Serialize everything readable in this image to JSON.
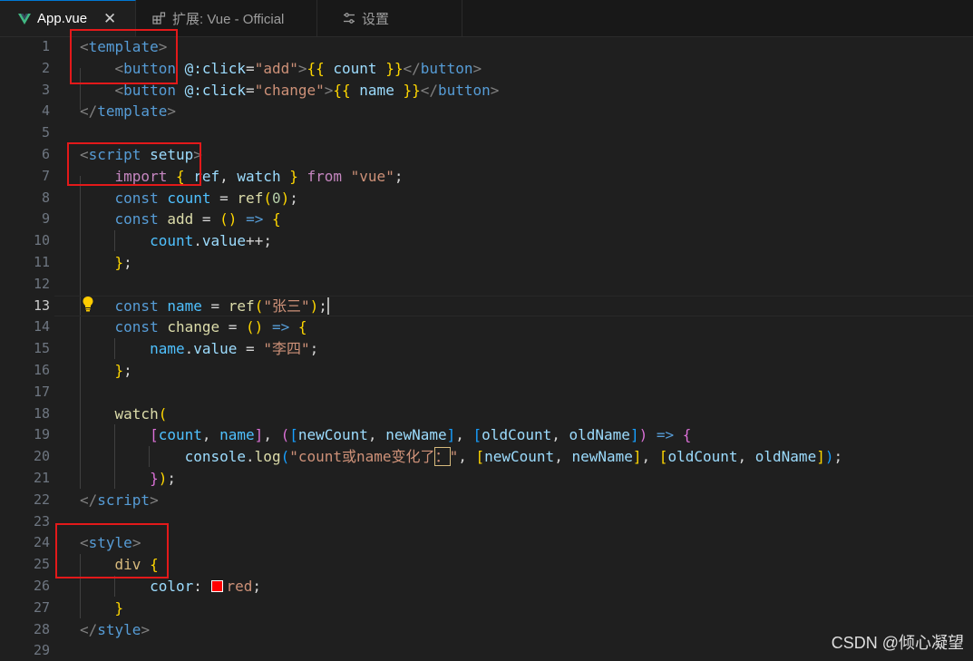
{
  "tabs": [
    {
      "label": "App.vue",
      "icon": "vue-file-icon",
      "close": "✕",
      "active": true
    },
    {
      "label": "扩展: Vue - Official",
      "icon": "extensions-icon",
      "active": false
    },
    {
      "label": "设置",
      "icon": "settings-icon",
      "active": false
    }
  ],
  "editor": {
    "current_line": 13,
    "lines": [
      {
        "n": "1"
      },
      {
        "n": "2"
      },
      {
        "n": "3"
      },
      {
        "n": "4"
      },
      {
        "n": "5"
      },
      {
        "n": "6"
      },
      {
        "n": "7"
      },
      {
        "n": "8"
      },
      {
        "n": "9"
      },
      {
        "n": "10"
      },
      {
        "n": "11"
      },
      {
        "n": "12"
      },
      {
        "n": "13"
      },
      {
        "n": "14"
      },
      {
        "n": "15"
      },
      {
        "n": "16"
      },
      {
        "n": "17"
      },
      {
        "n": "18"
      },
      {
        "n": "19"
      },
      {
        "n": "20"
      },
      {
        "n": "21"
      },
      {
        "n": "22"
      },
      {
        "n": "23"
      },
      {
        "n": "24"
      },
      {
        "n": "25"
      },
      {
        "n": "26"
      },
      {
        "n": "27"
      },
      {
        "n": "28"
      },
      {
        "n": "29"
      }
    ],
    "code": [
      [
        [
          "t-pun",
          "<"
        ],
        [
          "t-tag",
          "template"
        ],
        [
          "t-pun",
          ">"
        ]
      ],
      [
        [
          "t-txt",
          "    "
        ],
        [
          "t-pun",
          "<"
        ],
        [
          "t-tag",
          "button"
        ],
        [
          "t-txt",
          " "
        ],
        [
          "t-attr",
          "@:click"
        ],
        [
          "t-txt",
          "="
        ],
        [
          "t-str",
          "\"add\""
        ],
        [
          "t-pun",
          ">"
        ],
        [
          "t-y",
          "{{"
        ],
        [
          "t-var",
          " count "
        ],
        [
          "t-y",
          "}}"
        ],
        [
          "t-pun",
          "</"
        ],
        [
          "t-tag",
          "button"
        ],
        [
          "t-pun",
          ">"
        ]
      ],
      [
        [
          "t-txt",
          "    "
        ],
        [
          "t-pun",
          "<"
        ],
        [
          "t-tag",
          "button"
        ],
        [
          "t-txt",
          " "
        ],
        [
          "t-attr",
          "@:click"
        ],
        [
          "t-txt",
          "="
        ],
        [
          "t-str",
          "\"change\""
        ],
        [
          "t-pun",
          ">"
        ],
        [
          "t-y",
          "{{"
        ],
        [
          "t-var",
          " name "
        ],
        [
          "t-y",
          "}}"
        ],
        [
          "t-pun",
          "</"
        ],
        [
          "t-tag",
          "button"
        ],
        [
          "t-pun",
          ">"
        ]
      ],
      [
        [
          "t-pun",
          "</"
        ],
        [
          "t-tag",
          "template"
        ],
        [
          "t-pun",
          ">"
        ]
      ],
      [],
      [
        [
          "t-pun",
          "<"
        ],
        [
          "t-tag",
          "script"
        ],
        [
          "t-txt",
          " "
        ],
        [
          "t-attr",
          "setup"
        ],
        [
          "t-pun",
          ">"
        ]
      ],
      [
        [
          "t-txt",
          "    "
        ],
        [
          "t-ctrl",
          "import"
        ],
        [
          "t-txt",
          " "
        ],
        [
          "t-y",
          "{"
        ],
        [
          "t-var",
          " ref"
        ],
        [
          "t-txt",
          ", "
        ],
        [
          "t-var",
          "watch "
        ],
        [
          "t-y",
          "}"
        ],
        [
          "t-txt",
          " "
        ],
        [
          "t-ctrl",
          "from"
        ],
        [
          "t-txt",
          " "
        ],
        [
          "t-str",
          "\"vue\""
        ],
        [
          "t-txt",
          ";"
        ]
      ],
      [
        [
          "t-txt",
          "    "
        ],
        [
          "t-kw",
          "const"
        ],
        [
          "t-txt",
          " "
        ],
        [
          "t-const",
          "count"
        ],
        [
          "t-txt",
          " = "
        ],
        [
          "t-fn",
          "ref"
        ],
        [
          "t-y",
          "("
        ],
        [
          "t-num",
          "0"
        ],
        [
          "t-y",
          ")"
        ],
        [
          "t-txt",
          ";"
        ]
      ],
      [
        [
          "t-txt",
          "    "
        ],
        [
          "t-kw",
          "const"
        ],
        [
          "t-txt",
          " "
        ],
        [
          "t-fn",
          "add"
        ],
        [
          "t-txt",
          " = "
        ],
        [
          "t-y",
          "()"
        ],
        [
          "t-txt",
          " "
        ],
        [
          "t-kw",
          "=>"
        ],
        [
          "t-txt",
          " "
        ],
        [
          "t-y",
          "{"
        ]
      ],
      [
        [
          "t-txt",
          "        "
        ],
        [
          "t-const",
          "count"
        ],
        [
          "t-txt",
          "."
        ],
        [
          "t-var",
          "value"
        ],
        [
          "t-txt",
          "++;"
        ]
      ],
      [
        [
          "t-txt",
          "    "
        ],
        [
          "t-y",
          "}"
        ],
        [
          "t-txt",
          ";"
        ]
      ],
      [],
      [
        [
          "t-txt",
          "    "
        ],
        [
          "t-kw",
          "const"
        ],
        [
          "t-txt",
          " "
        ],
        [
          "t-const",
          "name"
        ],
        [
          "t-txt",
          " = "
        ],
        [
          "t-fn",
          "ref"
        ],
        [
          "t-y",
          "("
        ],
        [
          "t-str",
          "\"张三\""
        ],
        [
          "t-y",
          ")"
        ],
        [
          "t-txt",
          ";"
        ],
        [
          "cursor",
          ""
        ]
      ],
      [
        [
          "t-txt",
          "    "
        ],
        [
          "t-kw",
          "const"
        ],
        [
          "t-txt",
          " "
        ],
        [
          "t-fn",
          "change"
        ],
        [
          "t-txt",
          " = "
        ],
        [
          "t-y",
          "()"
        ],
        [
          "t-txt",
          " "
        ],
        [
          "t-kw",
          "=>"
        ],
        [
          "t-txt",
          " "
        ],
        [
          "t-y",
          "{"
        ]
      ],
      [
        [
          "t-txt",
          "        "
        ],
        [
          "t-const",
          "name"
        ],
        [
          "t-txt",
          "."
        ],
        [
          "t-var",
          "value"
        ],
        [
          "t-txt",
          " = "
        ],
        [
          "t-str",
          "\"李四\""
        ],
        [
          "t-txt",
          ";"
        ]
      ],
      [
        [
          "t-txt",
          "    "
        ],
        [
          "t-y",
          "}"
        ],
        [
          "t-txt",
          ";"
        ]
      ],
      [],
      [
        [
          "t-txt",
          "    "
        ],
        [
          "t-fn",
          "watch"
        ],
        [
          "t-y",
          "("
        ]
      ],
      [
        [
          "t-txt",
          "        "
        ],
        [
          "t-p",
          "["
        ],
        [
          "t-const",
          "count"
        ],
        [
          "t-txt",
          ", "
        ],
        [
          "t-const",
          "name"
        ],
        [
          "t-p",
          "]"
        ],
        [
          "t-txt",
          ", "
        ],
        [
          "t-p",
          "("
        ],
        [
          "t-b",
          "["
        ],
        [
          "t-var",
          "newCount"
        ],
        [
          "t-txt",
          ", "
        ],
        [
          "t-var",
          "newName"
        ],
        [
          "t-b",
          "]"
        ],
        [
          "t-txt",
          ", "
        ],
        [
          "t-b",
          "["
        ],
        [
          "t-var",
          "oldCount"
        ],
        [
          "t-txt",
          ", "
        ],
        [
          "t-var",
          "oldName"
        ],
        [
          "t-b",
          "]"
        ],
        [
          "t-p",
          ")"
        ],
        [
          "t-txt",
          " "
        ],
        [
          "t-kw",
          "=>"
        ],
        [
          "t-txt",
          " "
        ],
        [
          "t-p",
          "{"
        ]
      ],
      [
        [
          "t-txt",
          "            "
        ],
        [
          "t-var",
          "console"
        ],
        [
          "t-txt",
          "."
        ],
        [
          "t-fn",
          "log"
        ],
        [
          "t-b",
          "("
        ],
        [
          "t-str",
          "\"count或name变化了"
        ],
        [
          "t-str boxed",
          "："
        ],
        [
          "t-str",
          "\""
        ],
        [
          "t-txt",
          ", "
        ],
        [
          "t-y",
          "["
        ],
        [
          "t-var",
          "newCount"
        ],
        [
          "t-txt",
          ", "
        ],
        [
          "t-var",
          "newName"
        ],
        [
          "t-y",
          "]"
        ],
        [
          "t-txt",
          ", "
        ],
        [
          "t-y",
          "["
        ],
        [
          "t-var",
          "oldCount"
        ],
        [
          "t-txt",
          ", "
        ],
        [
          "t-var",
          "oldName"
        ],
        [
          "t-y",
          "]"
        ],
        [
          "t-b",
          ")"
        ],
        [
          "t-txt",
          ";"
        ]
      ],
      [
        [
          "t-txt",
          "        "
        ],
        [
          "t-p",
          "}"
        ],
        [
          "t-y",
          ")"
        ],
        [
          "t-txt",
          ";"
        ]
      ],
      [
        [
          "t-pun",
          "</"
        ],
        [
          "t-tag",
          "script"
        ],
        [
          "t-pun",
          ">"
        ]
      ],
      [],
      [
        [
          "t-pun",
          "<"
        ],
        [
          "t-tag",
          "style"
        ],
        [
          "t-pun",
          ">"
        ]
      ],
      [
        [
          "t-txt",
          "    "
        ],
        [
          "t-sel",
          "div"
        ],
        [
          "t-txt",
          " "
        ],
        [
          "t-y",
          "{"
        ]
      ],
      [
        [
          "t-txt",
          "        "
        ],
        [
          "t-attr",
          "color"
        ],
        [
          "t-txt",
          ": "
        ],
        [
          "swatch",
          ""
        ],
        [
          "t-str",
          "red"
        ],
        [
          "t-txt",
          ";"
        ]
      ],
      [
        [
          "t-txt",
          "    "
        ],
        [
          "t-y",
          "}"
        ]
      ],
      [
        [
          "t-pun",
          "</"
        ],
        [
          "t-tag",
          "style"
        ],
        [
          "t-pun",
          ">"
        ]
      ],
      []
    ]
  },
  "colors": {
    "accent": "#0078d4",
    "highlight_box": "#e3191a",
    "background": "#1f1f1f"
  },
  "watermark": "CSDN @倾心凝望"
}
